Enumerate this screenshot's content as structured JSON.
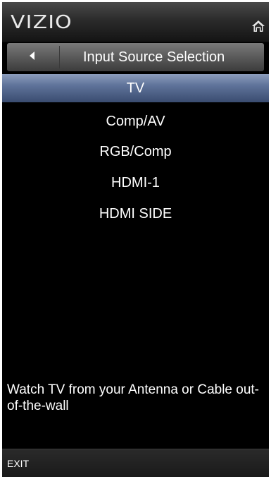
{
  "brand": {
    "logo_text": "VIZIO",
    "home_icon": "home-icon"
  },
  "header": {
    "title": "Input Source Selection",
    "back_icon": "left-arrow-icon"
  },
  "menu": {
    "items": [
      {
        "label": "TV",
        "selected": true
      },
      {
        "label": "Comp/AV",
        "selected": false
      },
      {
        "label": "RGB/Comp",
        "selected": false
      },
      {
        "label": "HDMI-1",
        "selected": false
      },
      {
        "label": "HDMI SIDE",
        "selected": false
      }
    ]
  },
  "description": {
    "text": "Watch TV from your Antenna or Cable out-of-the-wall"
  },
  "footer": {
    "exit_label": "EXIT"
  },
  "colors": {
    "background": "#000000",
    "selection": "#5f739a",
    "text": "#ffffff"
  }
}
